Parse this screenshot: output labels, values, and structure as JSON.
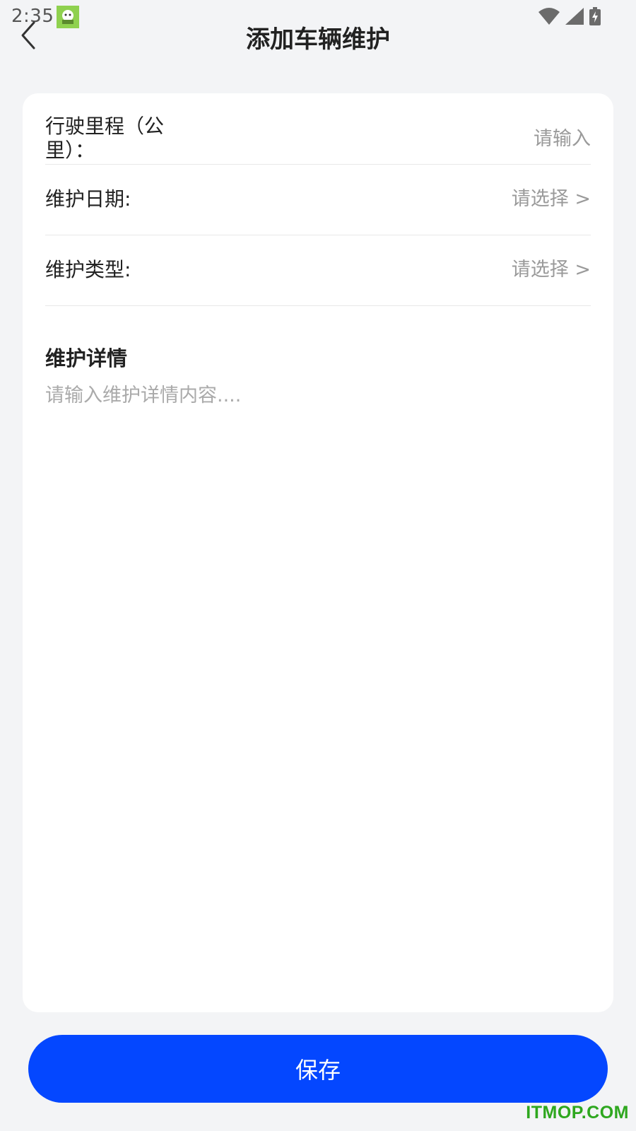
{
  "status_bar": {
    "time": "2:35",
    "icons": [
      "wifi-icon",
      "cellular-signal-icon",
      "battery-charging-icon"
    ]
  },
  "header": {
    "title": "添加车辆维护",
    "back_icon": "chevron-left-icon"
  },
  "form": {
    "mileage": {
      "label": "行驶里程（公里）：",
      "placeholder": "请输入"
    },
    "date": {
      "label": "维护日期:",
      "value": "请选择 >"
    },
    "type": {
      "label": "维护类型:",
      "value": "请选择 >"
    }
  },
  "details": {
    "title": "维护详情",
    "placeholder": "请输入维护详情内容...."
  },
  "actions": {
    "save_label": "保存"
  },
  "watermark": "ITMOP.COM",
  "colors": {
    "accent": "#0447ff",
    "background": "#f3f4f6",
    "card": "#ffffff",
    "placeholder": "#9a9a9a",
    "watermark": "#2ea71f"
  }
}
